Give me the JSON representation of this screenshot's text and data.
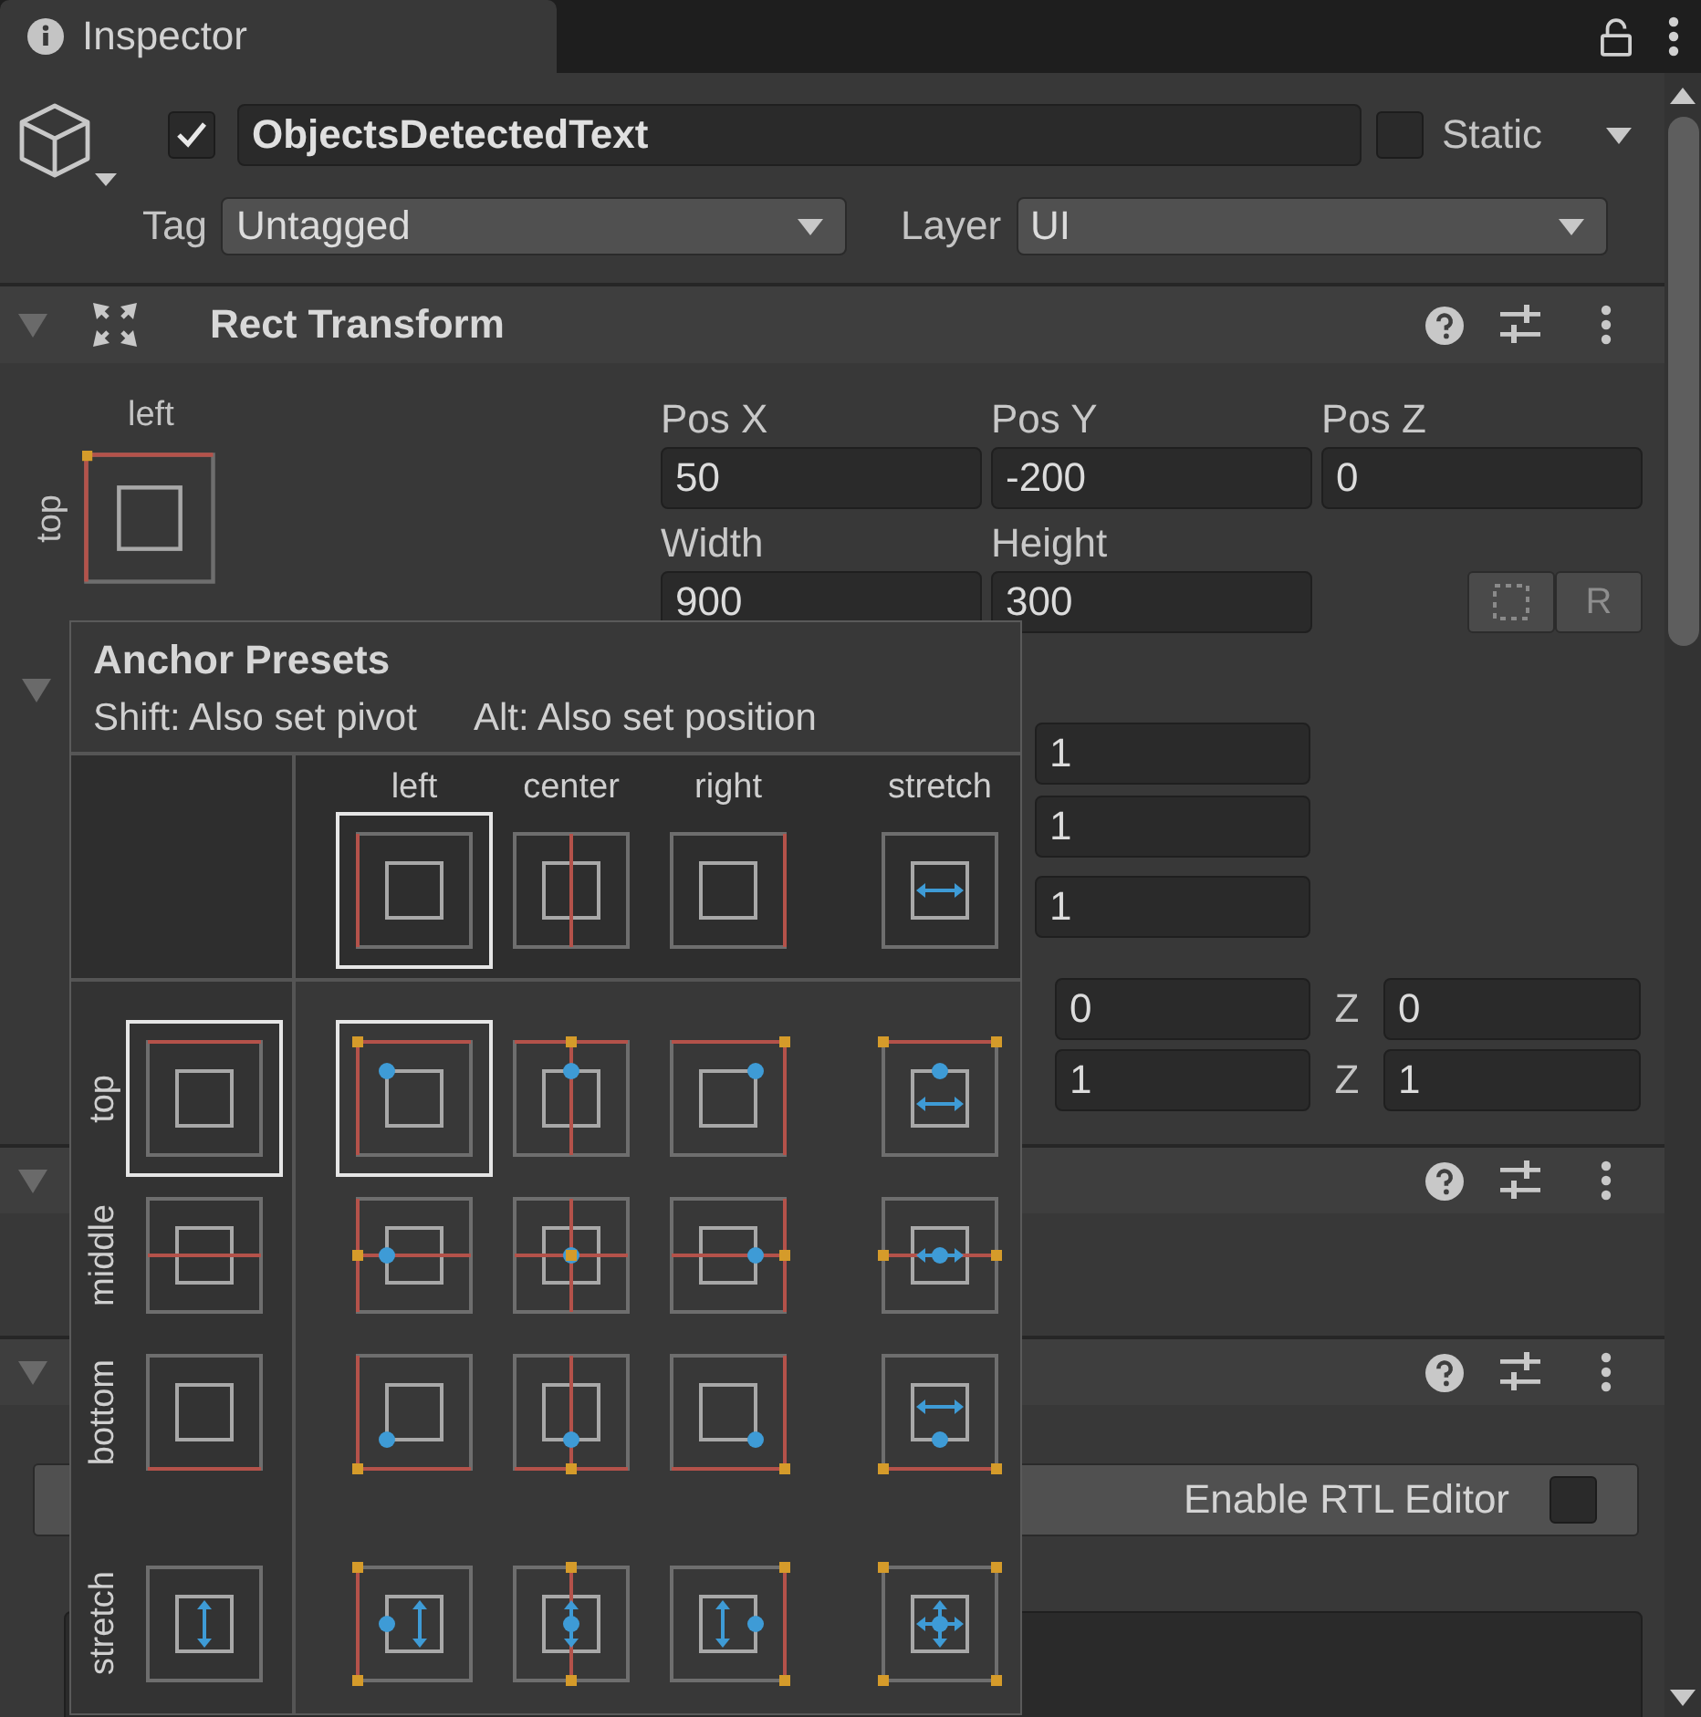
{
  "tab": {
    "title": "Inspector"
  },
  "object": {
    "active": true,
    "name": "ObjectsDetectedText",
    "static": false,
    "static_label": "Static",
    "tag_label": "Tag",
    "tag": "Untagged",
    "layer_label": "Layer",
    "layer": "UI"
  },
  "rect_transform": {
    "title": "Rect Transform",
    "expanded": true,
    "anchor_h": {
      "label": "left",
      "kind": "left"
    },
    "anchor_v": {
      "label": "top",
      "kind": "top"
    },
    "fields": [
      {
        "label": "Pos X",
        "value": "50"
      },
      {
        "label": "Pos Y",
        "value": "-200"
      },
      {
        "label": "Pos Z",
        "value": "0"
      },
      {
        "label": "Width",
        "value": "900"
      },
      {
        "label": "Height",
        "value": "300"
      }
    ],
    "raw_button": "R"
  },
  "transform_section": {
    "expanded": true,
    "values": [
      "1",
      "1",
      "1"
    ],
    "vector_rows": [
      {
        "value": "0",
        "z_label": "Z",
        "z_value": "0"
      },
      {
        "value": "1",
        "z_label": "Z",
        "z_value": "1"
      }
    ]
  },
  "components": [
    {
      "expanded": true
    },
    {
      "expanded": true,
      "toggle": {
        "label": "Enable RTL Editor",
        "checked": false
      }
    }
  ],
  "anchor_presets": {
    "title": "Anchor Presets",
    "hints": [
      "Shift: Also set pivot",
      "Alt: Also set position"
    ],
    "columns": [
      {
        "label": "left",
        "kind": "left",
        "selected": true
      },
      {
        "label": "center",
        "kind": "center",
        "selected": false
      },
      {
        "label": "right",
        "kind": "right",
        "selected": false
      },
      {
        "label": "stretch",
        "kind": "stretch",
        "selected": false
      }
    ],
    "rows": [
      {
        "label": "top",
        "kind": "top",
        "selected": true
      },
      {
        "label": "middle",
        "kind": "middle",
        "selected": false
      },
      {
        "label": "bottom",
        "kind": "bottom",
        "selected": false
      },
      {
        "label": "stretch",
        "kind": "stretch",
        "selected": false
      }
    ],
    "grid": [
      [
        {
          "selected": true
        },
        {
          "selected": false
        },
        {
          "selected": false
        },
        {
          "selected": false
        }
      ],
      [
        {
          "selected": false
        },
        {
          "selected": false
        },
        {
          "selected": false
        },
        {
          "selected": false
        }
      ],
      [
        {
          "selected": false
        },
        {
          "selected": false
        },
        {
          "selected": false
        },
        {
          "selected": false
        }
      ],
      [
        {
          "selected": false
        },
        {
          "selected": false
        },
        {
          "selected": false
        },
        {
          "selected": false
        }
      ]
    ]
  }
}
